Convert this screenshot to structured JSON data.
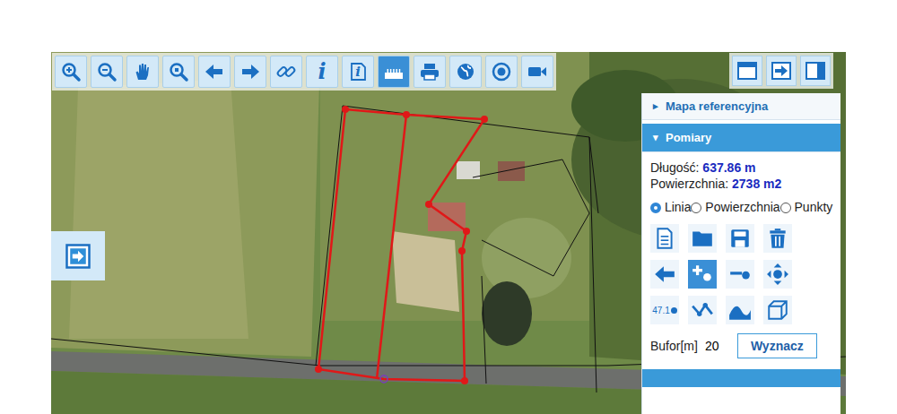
{
  "toolbar": {
    "tools": [
      {
        "kind": "zoom-in",
        "label": "",
        "selected": false
      },
      {
        "kind": "zoom-out",
        "label": "",
        "selected": false
      },
      {
        "kind": "pan",
        "label": "",
        "selected": false
      },
      {
        "kind": "zoom-box",
        "label": "",
        "selected": false
      },
      {
        "kind": "back",
        "label": "",
        "selected": false
      },
      {
        "kind": "forward",
        "label": "",
        "selected": false
      },
      {
        "kind": "link",
        "label": "",
        "selected": false
      },
      {
        "kind": "info",
        "label": "i",
        "selected": false
      },
      {
        "kind": "info-doc",
        "label": "i",
        "selected": false
      },
      {
        "kind": "ruler",
        "label": "",
        "selected": true
      },
      {
        "kind": "print",
        "label": "",
        "selected": false
      },
      {
        "kind": "globe",
        "label": "",
        "selected": false
      },
      {
        "kind": "target",
        "label": "",
        "selected": false
      },
      {
        "kind": "camera",
        "label": "",
        "selected": false
      }
    ]
  },
  "view_buttons": [
    {
      "kind": "window"
    },
    {
      "kind": "dock"
    },
    {
      "kind": "panel"
    }
  ],
  "panel": {
    "sections": [
      {
        "title": "Mapa referencyjna",
        "marker": "▸",
        "expanded": false
      },
      {
        "title": "Pomiary",
        "marker": "▾",
        "expanded": true
      }
    ],
    "measure": {
      "length_label": "Długość:",
      "length": "637.86 m",
      "area_label": "Powierzchnia:",
      "area": "2738 m2"
    },
    "modes": [
      {
        "label": "Linia",
        "selected": true
      },
      {
        "label": "Powierzchnia",
        "selected": false
      },
      {
        "label": "Punkty",
        "selected": false
      }
    ],
    "tools": [
      {
        "kind": "new",
        "label": "",
        "selected": false
      },
      {
        "kind": "open",
        "label": "",
        "selected": false
      },
      {
        "kind": "save",
        "label": "",
        "selected": false
      },
      {
        "kind": "delete",
        "label": "",
        "selected": false
      },
      {
        "kind": "undo",
        "label": "",
        "selected": false
      },
      {
        "kind": "add-point",
        "label": "",
        "selected": true
      },
      {
        "kind": "line-point",
        "label": "",
        "selected": false
      },
      {
        "kind": "move",
        "label": "",
        "selected": false
      },
      {
        "kind": "label-point",
        "label": "47.1",
        "selected": false
      },
      {
        "kind": "polyline",
        "label": "",
        "selected": false
      },
      {
        "kind": "curve",
        "label": "",
        "selected": false
      },
      {
        "kind": "cube",
        "label": "",
        "selected": false
      }
    ],
    "buffer": {
      "label": "Bufor[m]",
      "value": "20"
    },
    "button": "Wyznacz"
  }
}
